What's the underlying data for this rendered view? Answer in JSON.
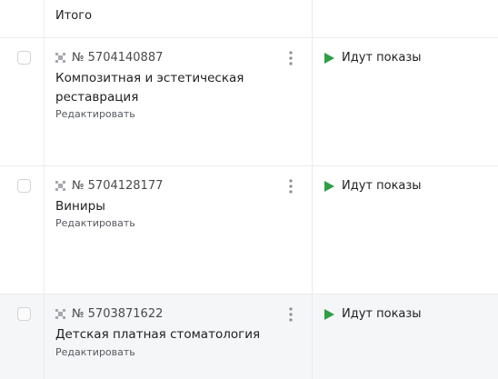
{
  "header": {
    "total_label": "Итого"
  },
  "rows": [
    {
      "number": "№ 5704140887",
      "title": "Композитная и эстетическая реставрация",
      "edit_label": "Редактировать",
      "status": "Идут показы"
    },
    {
      "number": "№ 5704128177",
      "title": "Виниры",
      "edit_label": "Редактировать",
      "status": "Идут показы"
    },
    {
      "number": "№ 5703871622",
      "title": "Детская платная стоматология",
      "edit_label": "Редактировать",
      "status": "Идут показы"
    }
  ],
  "colors": {
    "status_active": "#2f9e44",
    "hover_row_bg": "#f5f6f8",
    "border": "#ececec"
  },
  "icons": {
    "ad_type": "ad-type-icon",
    "menu": "kebab-menu-icon",
    "status": "play-icon"
  }
}
